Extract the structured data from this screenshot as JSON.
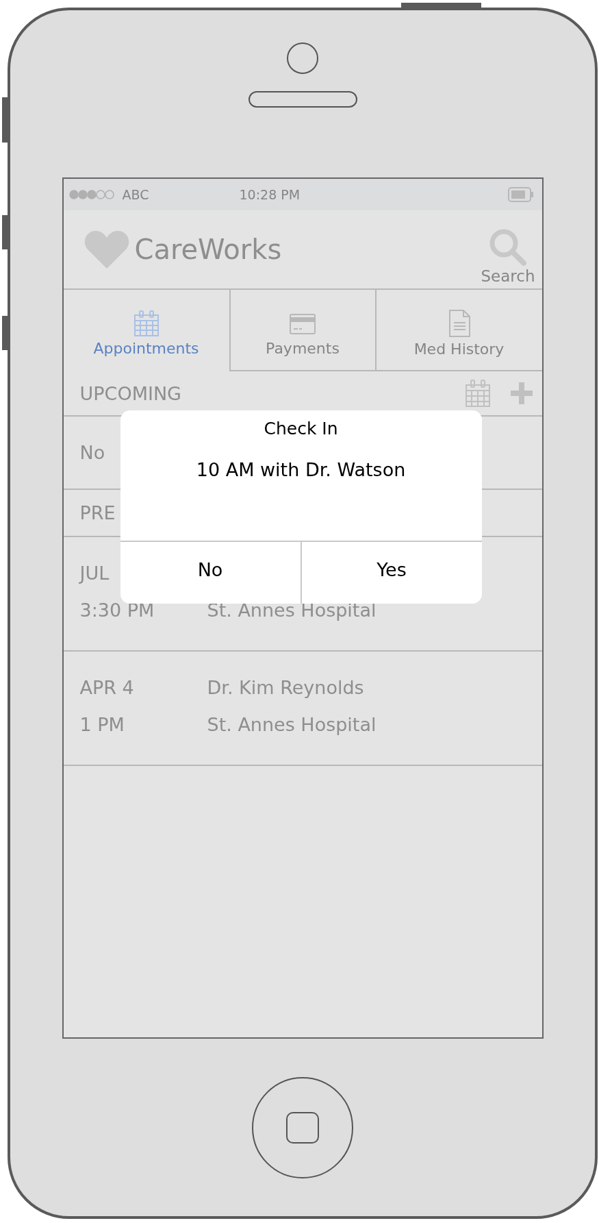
{
  "status_bar": {
    "carrier": "ABC",
    "time": "10:28 PM"
  },
  "header": {
    "app_name": "CareWorks",
    "search_label": "Search"
  },
  "tabs": [
    {
      "label": "Appointments",
      "selected": true
    },
    {
      "label": "Payments",
      "selected": false
    },
    {
      "label": "Med History",
      "selected": false
    }
  ],
  "upcoming": {
    "title": "UPCOMING",
    "empty_text": "No"
  },
  "previous": {
    "title": "PRE"
  },
  "appointments": [
    {
      "date": "JUL",
      "time": "3:30 PM",
      "place": "St. Annes Hospital"
    },
    {
      "date": "APR 4",
      "time": "1 PM",
      "doctor": "Dr. Kim Reynolds",
      "place": "St. Annes Hospital"
    }
  ],
  "dialog": {
    "title": "Check In",
    "message": "10 AM with Dr. Watson",
    "buttons": [
      "No",
      "Yes"
    ]
  }
}
